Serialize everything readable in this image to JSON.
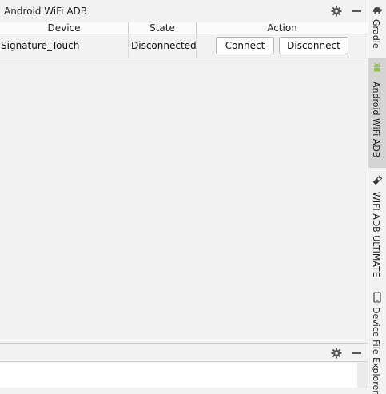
{
  "window": {
    "title": "Android WiFi ADB"
  },
  "toolbar": {
    "settings_icon": "gear-icon",
    "minimize_icon": "minimize-icon"
  },
  "table": {
    "columns": [
      "Device",
      "State",
      "Action"
    ],
    "rows": [
      {
        "device": "Signature_Touch",
        "state": "Disconnected",
        "actions": {
          "connect": "Connect",
          "disconnect": "Disconnect"
        }
      }
    ]
  },
  "sidebar": {
    "tabs": [
      {
        "label": "Gradle",
        "icon": "gradle-icon",
        "active": false
      },
      {
        "label": "Android WiFi ADB",
        "icon": "android-icon",
        "active": true
      },
      {
        "label": "WIFI ADB ULTIMATE",
        "icon": "usb-icon",
        "active": false
      },
      {
        "label": "Device File Explorer",
        "icon": "device-icon",
        "active": false
      }
    ]
  },
  "colors": {
    "background": "#f2f2f2",
    "active_tab": "#d4d4d4",
    "android_green": "#8bc34a",
    "border": "#c9c9c9"
  }
}
